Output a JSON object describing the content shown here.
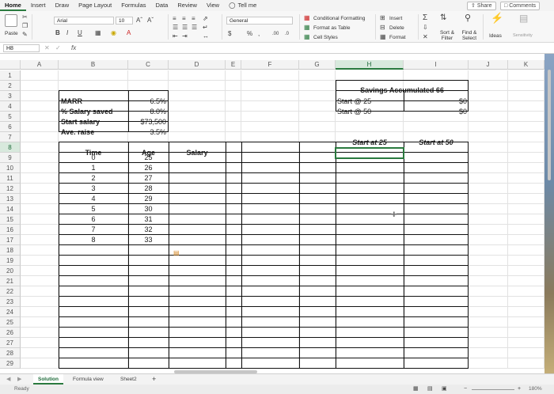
{
  "ribbon_tabs": [
    "Home",
    "Insert",
    "Draw",
    "Page Layout",
    "Formulas",
    "Data",
    "Review",
    "View"
  ],
  "tell_me": "Tell me",
  "share_label": "Share",
  "comments_label": "Comments",
  "ribbon": {
    "paste": "Paste",
    "font_name": "Arial",
    "font_size": "10",
    "number_format": "General",
    "conditional_formatting": "Conditional Formatting",
    "format_as_table": "Format as Table",
    "cell_styles": "Cell Styles",
    "insert": "Insert",
    "delete": "Delete",
    "format": "Format",
    "sort_filter_1": "Sort &",
    "sort_filter_2": "Filter",
    "find_select_1": "Find &",
    "find_select_2": "Select",
    "ideas": "Ideas",
    "sensitivity": "Sensitivity"
  },
  "name_box": "H8",
  "fx_label": "fx",
  "columns": [
    "A",
    "B",
    "C",
    "D",
    "E",
    "F",
    "G",
    "H",
    "I",
    "J",
    "K"
  ],
  "rows": [
    "1",
    "2",
    "3",
    "4",
    "5",
    "6",
    "7",
    "8",
    "9",
    "10",
    "11",
    "12",
    "13",
    "14",
    "15",
    "16",
    "17",
    "18",
    "19",
    "20",
    "21",
    "22",
    "23",
    "24",
    "25",
    "26",
    "27",
    "28",
    "29"
  ],
  "params": [
    {
      "label": "MARR",
      "value": "6.5%"
    },
    {
      "label": "% Salary saved",
      "value": "8.0%"
    },
    {
      "label": "Start salary",
      "value": "$73,500"
    },
    {
      "label": "Ave. raise",
      "value": "3.5%"
    }
  ],
  "savings": {
    "title": "Savings Accumulated 66",
    "rows": [
      {
        "label": "Start @ 25",
        "value": "$0"
      },
      {
        "label": "Start @ 50",
        "value": "$0"
      }
    ]
  },
  "start_at_25": "Start at 25",
  "start_at_50": "Start at 50",
  "table": {
    "headers": [
      "Time",
      "Age",
      "Salary"
    ],
    "rows": [
      {
        "time": "0",
        "age": "25"
      },
      {
        "time": "1",
        "age": "26"
      },
      {
        "time": "2",
        "age": "27"
      },
      {
        "time": "3",
        "age": "28"
      },
      {
        "time": "4",
        "age": "29"
      },
      {
        "time": "5",
        "age": "30"
      },
      {
        "time": "6",
        "age": "31"
      },
      {
        "time": "7",
        "age": "32"
      },
      {
        "time": "8",
        "age": "33"
      }
    ]
  },
  "sheet_tabs": [
    "Solution",
    "Formula view",
    "Sheet2"
  ],
  "add_sheet": "+",
  "status": "Ready",
  "zoom": "180%"
}
